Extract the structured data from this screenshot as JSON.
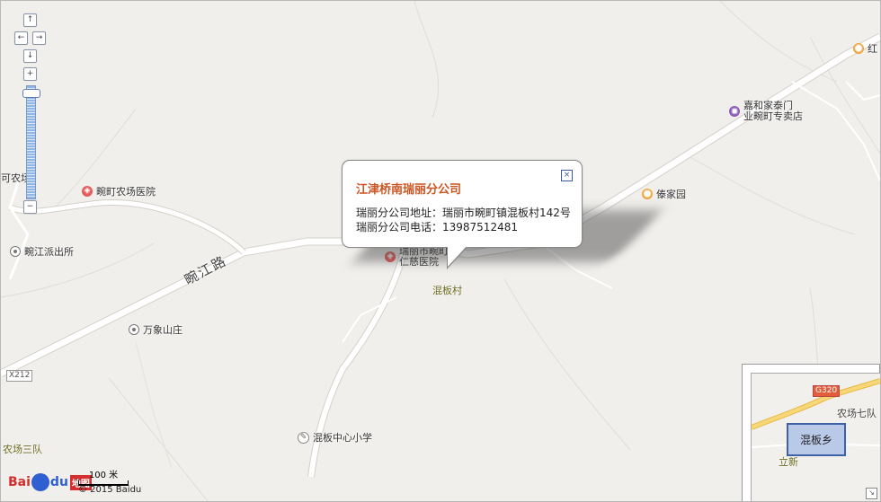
{
  "popup": {
    "title": "江津桥南瑞丽分公司",
    "address": "瑞丽分公司地址：瑞丽市畹町镇混板村142号",
    "phone": "瑞丽分公司电话：13987512481",
    "close_label": "×"
  },
  "pois": {
    "farm_hospital": "畹町农场医院",
    "police": "畹江派出所",
    "wanxiang": "万象山庄",
    "school": "混板中心小学",
    "jiahe_1": "嘉和家泰门",
    "jiahe_2": "业畹町专卖店",
    "tai_garden": "傣家园",
    "ren_ci_1": "瑞丽市畹町",
    "ren_ci_2": "仁慈医院",
    "hunban_village": "混板村",
    "farm3": "农场三队",
    "left_edge": "可农场",
    "top_right": "红"
  },
  "road": {
    "name": "畹江路",
    "x212": "X212"
  },
  "nav": {
    "up": "↑",
    "left": "←",
    "right": "→",
    "down": "↓",
    "zoom_in": "+",
    "zoom_out": "−"
  },
  "overview": {
    "label": "混板乡",
    "g320": "G320",
    "farm7": "农场七队",
    "lixin": "立新",
    "toggle": "↘"
  },
  "footer": {
    "logo_bai": "Bai",
    "logo_du": "du",
    "logo_map": "地图",
    "scale": "100 米",
    "copyright": "© 2015 Baidu"
  }
}
